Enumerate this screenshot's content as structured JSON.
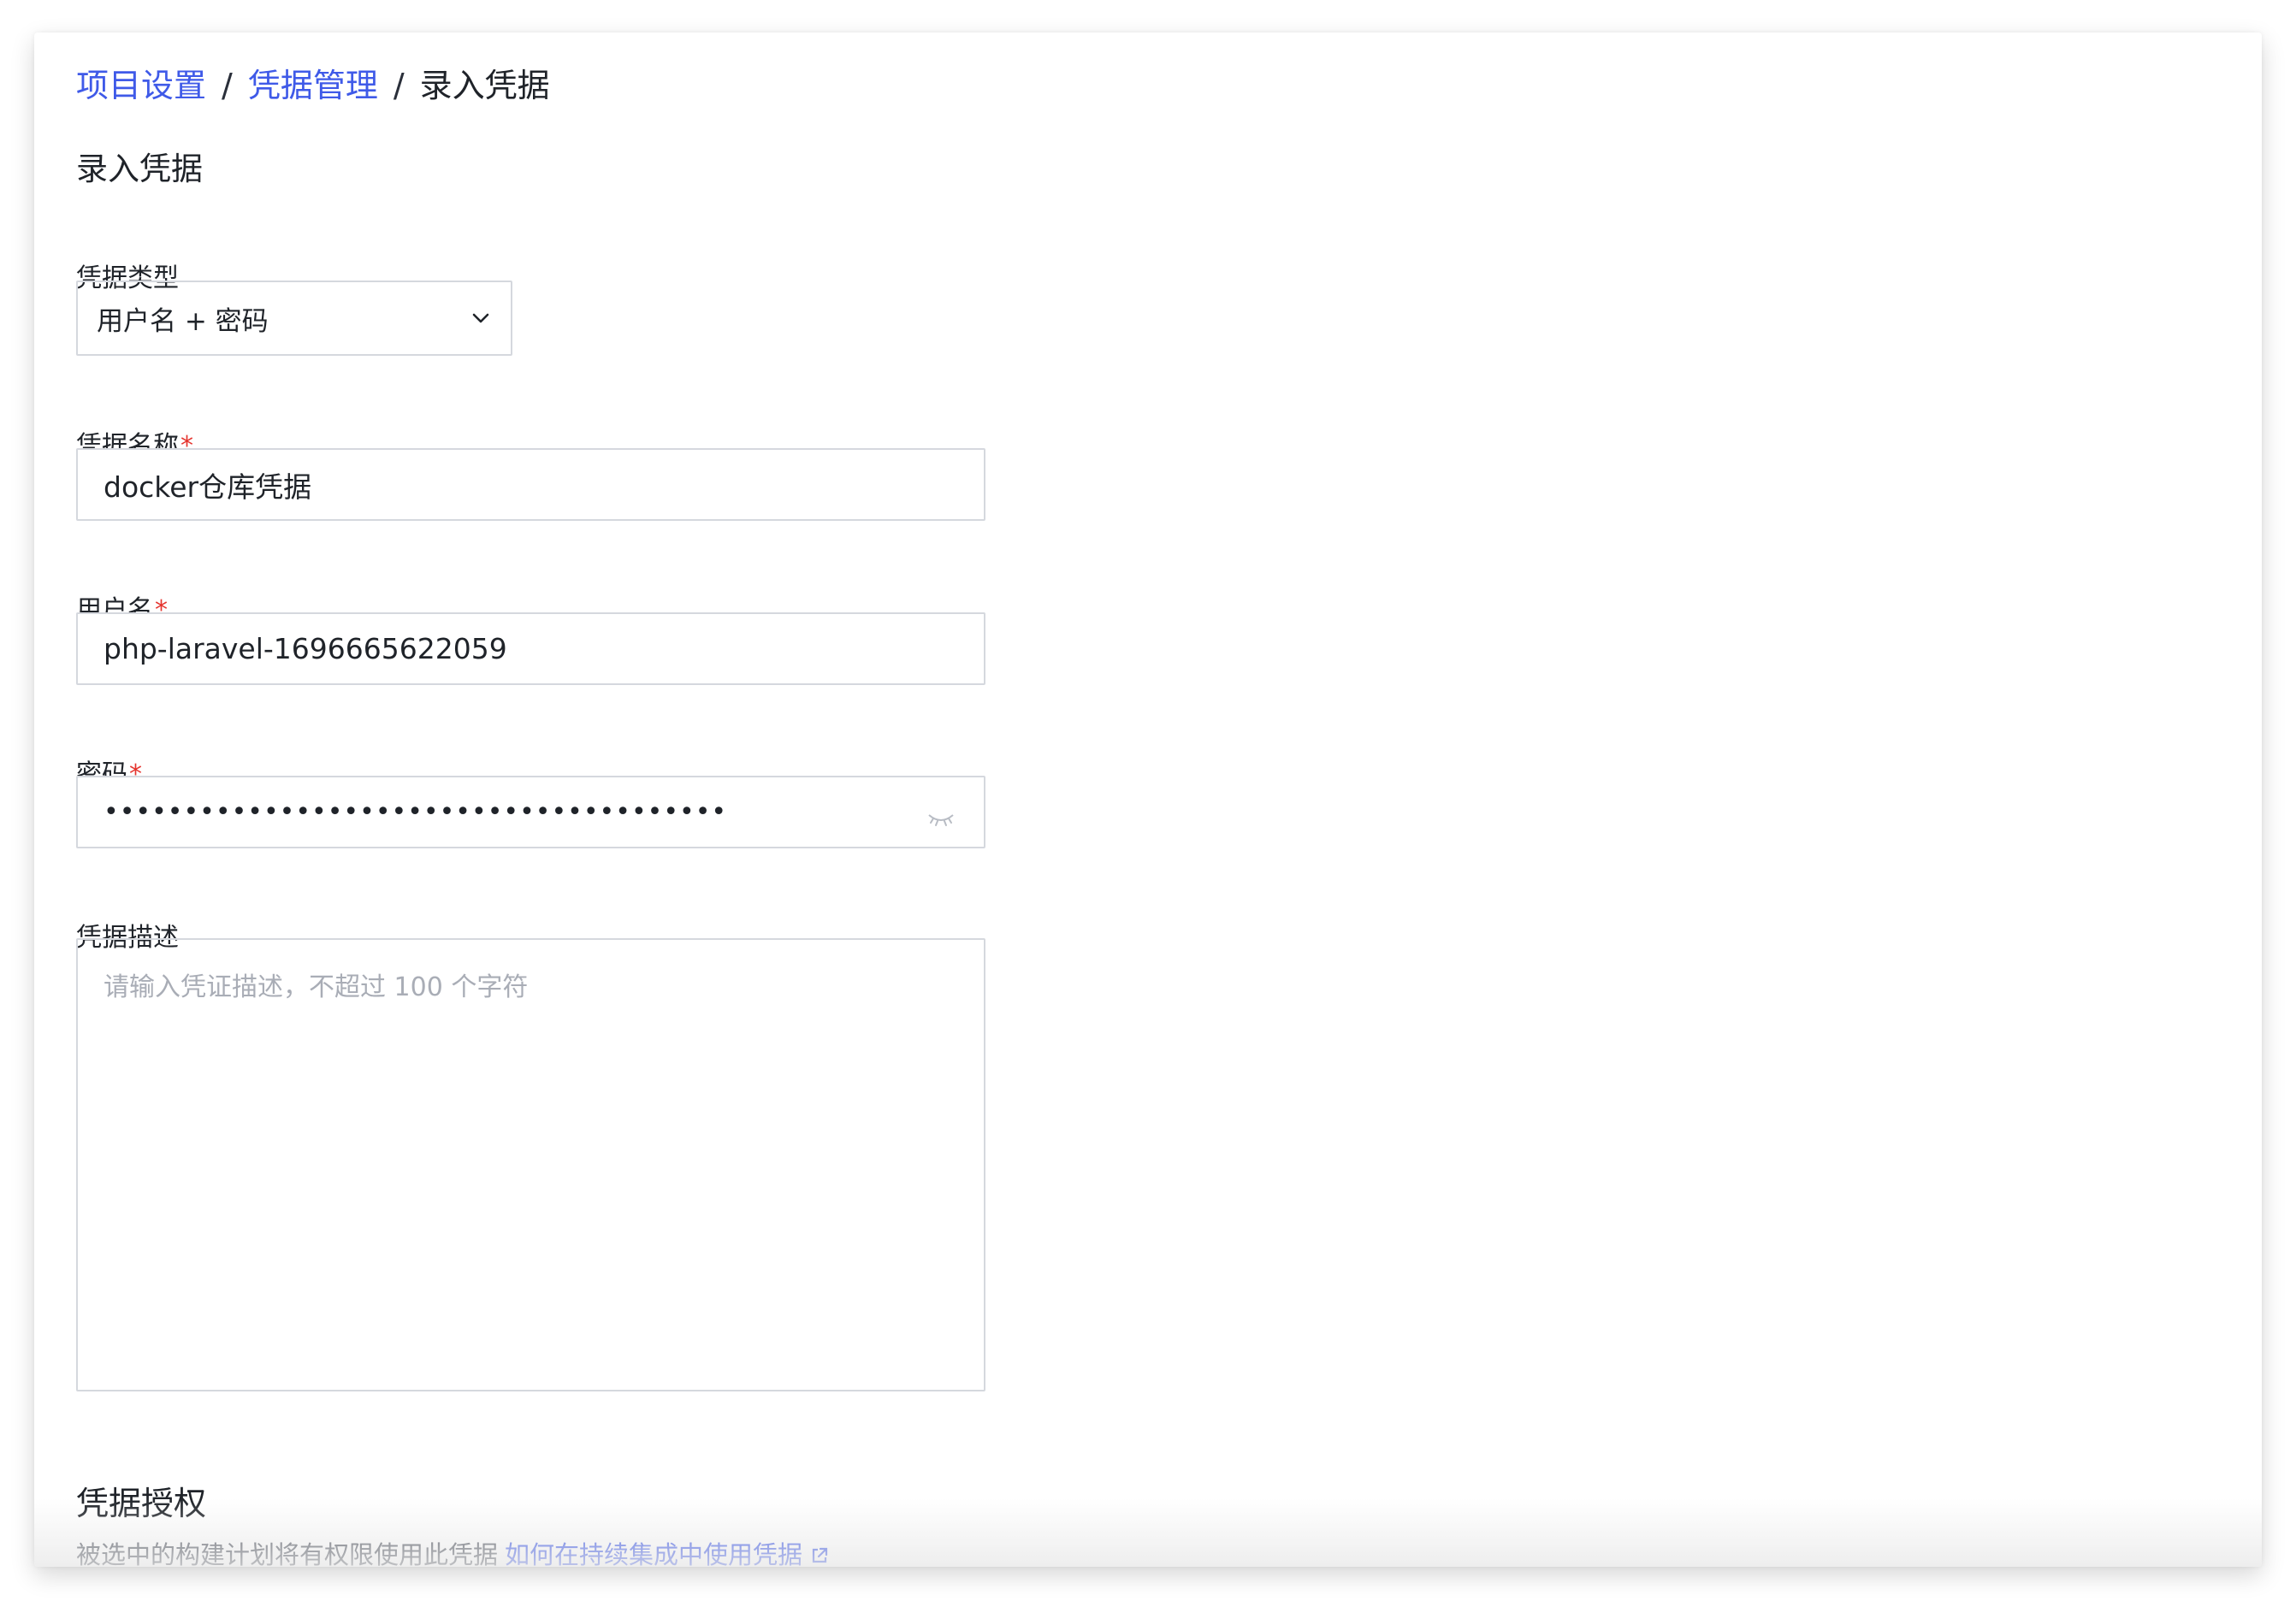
{
  "breadcrumb": {
    "items": [
      "项目设置",
      "凭据管理"
    ],
    "separator": "/",
    "current": "录入凭据"
  },
  "page_title": "录入凭据",
  "form": {
    "type": {
      "label": "凭据类型",
      "value": "用户名 + 密码"
    },
    "name": {
      "label": "凭据名称",
      "required": "*",
      "value": "docker仓库凭据"
    },
    "username": {
      "label": "用户名",
      "required": "*",
      "value": "php-laravel-1696665622059"
    },
    "password": {
      "label": "密码",
      "required": "*",
      "value": "•••••••••••••••••••••••••••••••••••••••"
    },
    "description": {
      "label": "凭据描述",
      "placeholder": "请输入凭证描述，不超过 100 个字符"
    }
  },
  "authorization": {
    "title": "凭据授权",
    "description": "被选中的构建计划将有权限使用此凭据",
    "link": "如何在持续集成中使用凭据"
  },
  "colors": {
    "accent": "#3f5ae8",
    "required": "#e5342e",
    "border": "#d5d8de",
    "placeholder": "#a9adb6"
  },
  "icons": [
    "chevron-down-icon",
    "eye-closed-icon",
    "external-link-icon"
  ]
}
